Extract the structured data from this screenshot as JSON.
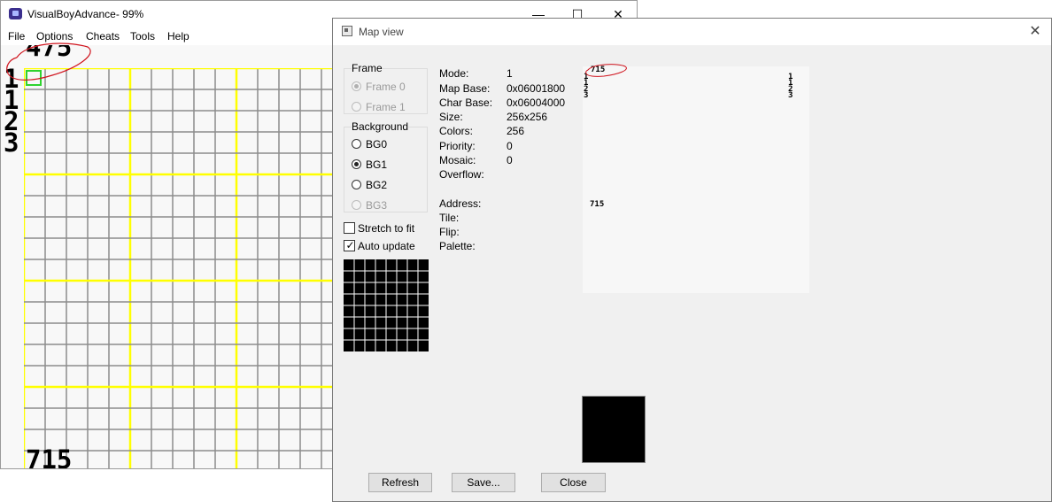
{
  "main_window": {
    "title": "VisualBoyAdvance- 99%",
    "controls": {
      "minimize": "—",
      "maximize": "☐",
      "close": "✕"
    },
    "menu": [
      "File",
      "Options",
      "Cheats",
      "Tools",
      "Help"
    ],
    "game_screen": {
      "top_number": "475",
      "left_digits": [
        "1",
        "1",
        "2",
        "3"
      ],
      "bottom_number": "715"
    }
  },
  "map_view": {
    "title": "Map view",
    "close_glyph": "✕",
    "frame": {
      "label": "Frame",
      "options": [
        {
          "label": "Frame 0",
          "checked": true,
          "disabled": true
        },
        {
          "label": "Frame 1",
          "checked": false,
          "disabled": true
        }
      ]
    },
    "background": {
      "label": "Background",
      "options": [
        {
          "label": "BG0",
          "checked": false,
          "disabled": false
        },
        {
          "label": "BG1",
          "checked": true,
          "disabled": false
        },
        {
          "label": "BG2",
          "checked": false,
          "disabled": false
        },
        {
          "label": "BG3",
          "checked": false,
          "disabled": true
        }
      ]
    },
    "stretch_to_fit": {
      "label": "Stretch to fit",
      "checked": false
    },
    "auto_update": {
      "label": "Auto update",
      "checked": true
    },
    "info": [
      {
        "label": "Mode:",
        "value": "1"
      },
      {
        "label": "Map Base:",
        "value": "0x06001800"
      },
      {
        "label": "Char Base:",
        "value": "0x06004000"
      },
      {
        "label": "Size:",
        "value": "256x256"
      },
      {
        "label": "Colors:",
        "value": "256"
      },
      {
        "label": "Priority:",
        "value": "0"
      },
      {
        "label": "Mosaic:",
        "value": "0"
      },
      {
        "label": "Overflow:",
        "value": ""
      }
    ],
    "tile_info": [
      {
        "label": "Address:",
        "value": ""
      },
      {
        "label": "Tile:",
        "value": ""
      },
      {
        "label": "Flip:",
        "value": ""
      },
      {
        "label": "Palette:",
        "value": ""
      }
    ],
    "map_preview": {
      "top_number": "715",
      "left_digits": [
        "1",
        "1",
        "2",
        "3"
      ],
      "right_digits": [
        "1",
        "1",
        "2",
        "3"
      ],
      "middle_number": "715"
    },
    "buttons": {
      "refresh": "Refresh",
      "save": "Save...",
      "close": "Close"
    }
  },
  "colors": {
    "grid_line": "#8c8c8c",
    "grid_major": "#ffff00",
    "selection": "#2fd32f",
    "annotation": "#d0141e"
  }
}
